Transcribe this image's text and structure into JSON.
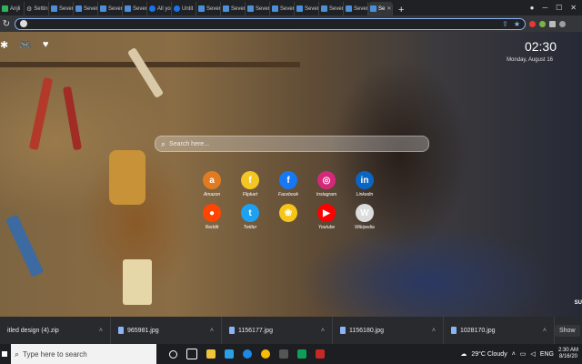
{
  "browser": {
    "tabs": [
      {
        "label": "Anjli",
        "icon": "green-square-icon"
      },
      {
        "label": "Settin",
        "icon": "gear-icon"
      },
      {
        "label": "Sever",
        "icon": "page-icon"
      },
      {
        "label": "Sever",
        "icon": "page-icon"
      },
      {
        "label": "Sever",
        "icon": "page-icon"
      },
      {
        "label": "Sever",
        "icon": "page-icon"
      },
      {
        "label": "All yo",
        "icon": "chrome-icon"
      },
      {
        "label": "Untit",
        "icon": "chrome-icon"
      },
      {
        "label": "Sever",
        "icon": "page-icon"
      },
      {
        "label": "Sever",
        "icon": "page-icon"
      },
      {
        "label": "Sever",
        "icon": "page-icon"
      },
      {
        "label": "Sever",
        "icon": "page-icon"
      },
      {
        "label": "Sever",
        "icon": "page-icon"
      },
      {
        "label": "Sever",
        "icon": "page-icon"
      },
      {
        "label": "Sever",
        "icon": "page-icon"
      },
      {
        "label": "Se",
        "icon": "page-icon",
        "active": true
      }
    ],
    "new_tab": "+",
    "omnibox_value": "",
    "accent": "#8ab4f8"
  },
  "newtab": {
    "time": "02:30",
    "date": "Monday, August 16",
    "search_placeholder": "Search here...",
    "sites": [
      {
        "label": "Amazon",
        "glyph": "a",
        "color": "#e07b22"
      },
      {
        "label": "Flipkart",
        "glyph": "f",
        "color": "#f3c623"
      },
      {
        "label": "Facebook",
        "glyph": "f",
        "color": "#1877f2"
      },
      {
        "label": "Instagram",
        "glyph": "◎",
        "color": "#d6287a"
      },
      {
        "label": "Linkedin",
        "glyph": "in",
        "color": "#0a66c2"
      },
      {
        "label": "Reddit",
        "glyph": "●",
        "color": "#ff4500"
      },
      {
        "label": "Twitter",
        "glyph": "t",
        "color": "#1da1f2"
      },
      {
        "label": "",
        "glyph": "❀",
        "color": "#f5c518"
      },
      {
        "label": "Youtube",
        "glyph": "▶",
        "color": "#ff0000"
      },
      {
        "label": "Wikipedia",
        "glyph": "W",
        "color": "#dcdcdc"
      }
    ],
    "corner_text": "SU"
  },
  "downloads": {
    "items": [
      "itled design (4).zip",
      "965981.jpg",
      "1156177.jpg",
      "1156180.jpg",
      "1028170.jpg"
    ],
    "show_all": "Show"
  },
  "taskbar": {
    "search_placeholder": "Type here to search",
    "weather": "29°C  Cloudy",
    "lang": "ENG",
    "time": "2:30 AM",
    "date": "8/16/20"
  }
}
